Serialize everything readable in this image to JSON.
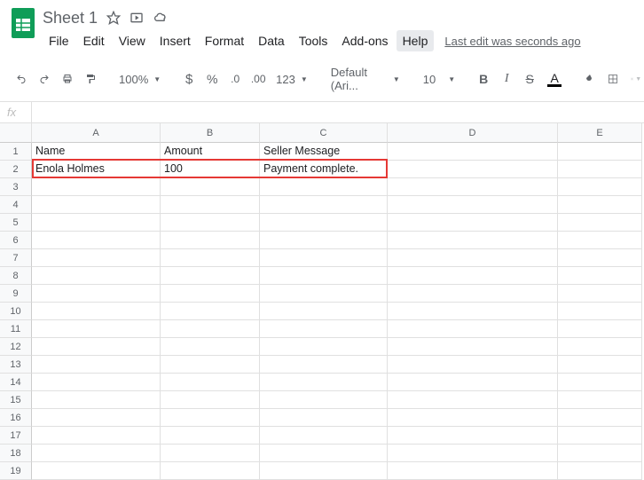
{
  "doc": {
    "title": "Sheet 1"
  },
  "menu": {
    "file": "File",
    "edit": "Edit",
    "view": "View",
    "insert": "Insert",
    "format": "Format",
    "data": "Data",
    "tools": "Tools",
    "addons": "Add-ons",
    "help": "Help",
    "last_edit": "Last edit was seconds ago"
  },
  "toolbar": {
    "zoom": "100%",
    "more_formats": "123",
    "font": "Default (Ari...",
    "font_size": "10",
    "bold": "B",
    "italic": "I",
    "strike": "S",
    "text_color_letter": "A"
  },
  "fx": {
    "label": "fx",
    "value": ""
  },
  "columns": [
    "A",
    "B",
    "C",
    "D",
    "E"
  ],
  "rows": [
    "1",
    "2",
    "3",
    "4",
    "5",
    "6",
    "7",
    "8",
    "9",
    "10",
    "11",
    "12",
    "13",
    "14",
    "15",
    "16",
    "17",
    "18",
    "19"
  ],
  "cells": {
    "r1": {
      "A": "Name",
      "B": "Amount",
      "C": "Seller Message"
    },
    "r2": {
      "A": "Enola Holmes",
      "B": "100",
      "C": "Payment complete."
    }
  }
}
